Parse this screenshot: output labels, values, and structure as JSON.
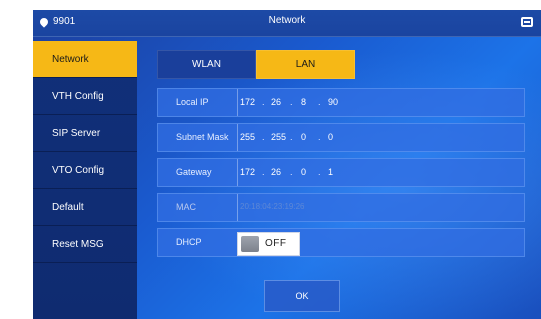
{
  "header": {
    "device_id": "9901",
    "title": "Network"
  },
  "sidebar": {
    "items": [
      {
        "label": "Network",
        "active": true
      },
      {
        "label": "VTH Config",
        "active": false
      },
      {
        "label": "SIP Server",
        "active": false
      },
      {
        "label": "VTO Config",
        "active": false
      },
      {
        "label": "Default",
        "active": false
      },
      {
        "label": "Reset MSG",
        "active": false
      }
    ]
  },
  "tabs": [
    {
      "label": "WLAN",
      "active": false
    },
    {
      "label": "LAN",
      "active": true
    }
  ],
  "fields": {
    "local_ip": {
      "label": "Local IP",
      "octets": [
        "172",
        "26",
        "8",
        "90"
      ]
    },
    "subnet_mask": {
      "label": "Subnet Mask",
      "octets": [
        "255",
        "255",
        "0",
        "0"
      ]
    },
    "gateway": {
      "label": "Gateway",
      "octets": [
        "172",
        "26",
        "0",
        "1"
      ]
    },
    "mac": {
      "label": "MAC",
      "value": "20:18:04:23:19:26"
    },
    "dhcp": {
      "label": "DHCP",
      "state": "OFF"
    }
  },
  "ok_label": "OK",
  "colors": {
    "accent": "#f6b816",
    "background": "#1a5bd0",
    "sidebar": "#11307a"
  }
}
